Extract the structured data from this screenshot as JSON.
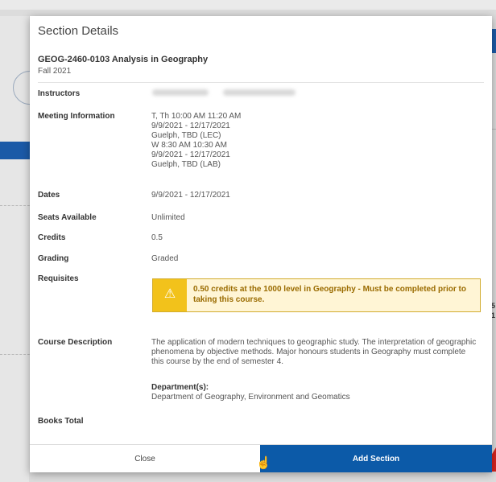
{
  "background": {
    "side_text": [
      "5",
      "1"
    ]
  },
  "modal": {
    "title": "Section Details",
    "course_code": "GEOG-2460-0103 Analysis in Geography",
    "term": "Fall 2021",
    "labels": {
      "instructors": "Instructors",
      "meeting_information": "Meeting Information",
      "dates": "Dates",
      "seats_available": "Seats Available",
      "credits": "Credits",
      "grading": "Grading",
      "requisites": "Requisites",
      "course_description": "Course Description",
      "books_total": "Books Total"
    },
    "meeting_information": [
      "T, Th 10:00 AM 11:20 AM",
      "9/9/2021 - 12/17/2021",
      "Guelph, TBD (LEC)",
      "W 8:30 AM 10:30 AM",
      "9/9/2021 - 12/17/2021",
      "Guelph, TBD (LAB)"
    ],
    "dates": "9/9/2021 - 12/17/2021",
    "seats_available": "Unlimited",
    "credits": "0.5",
    "grading": "Graded",
    "requisite_text": "0.50 credits at the 1000 level in Geography - Must be completed prior to taking this course.",
    "requisite_icon": "warning-icon",
    "course_description": "The application of modern techniques to geographic study. The interpretation of geographic phenomena by objective methods. Major honours students in Geography must complete this course by the end of semester 4.",
    "department_label": "Department(s):",
    "department_value": "Department of Geography, Environment and Geomatics",
    "buttons": {
      "close": "Close",
      "add_section": "Add Section"
    }
  },
  "colors": {
    "primary_button": "#0c5aa8",
    "warning_bg": "#fff5d5",
    "warning_icon_bg": "#f2c21b",
    "warning_text": "#9a6b00"
  }
}
